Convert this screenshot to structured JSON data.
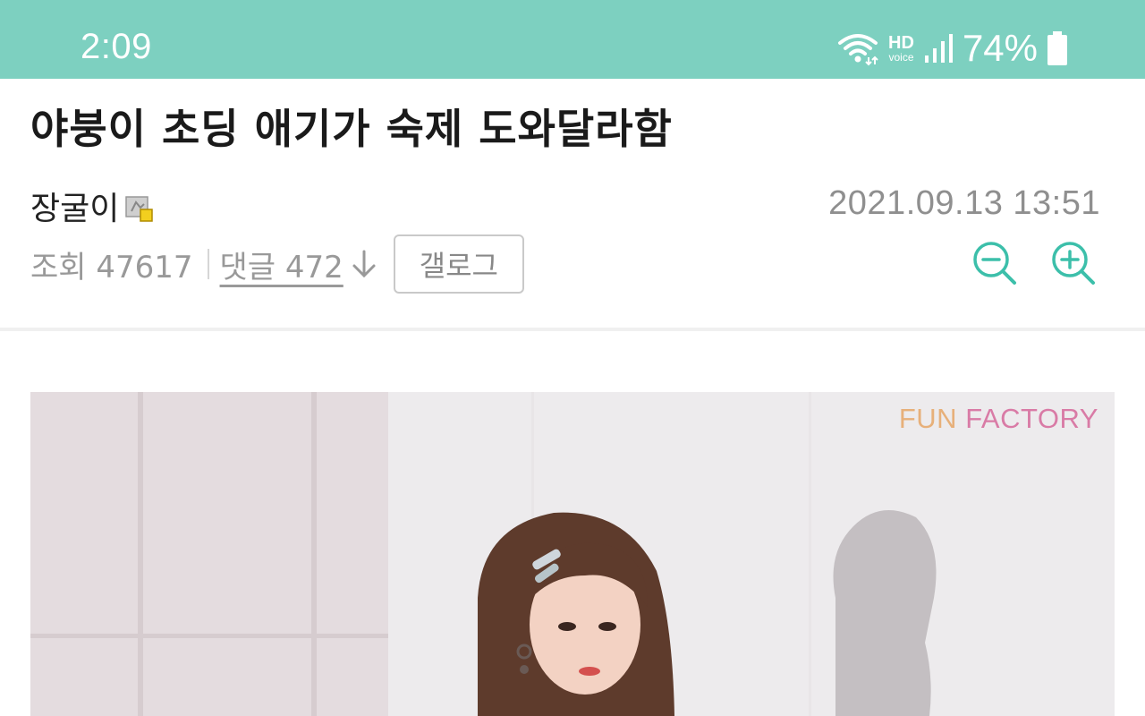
{
  "status_bar": {
    "time": "2:09",
    "network_label": "HD",
    "network_sublabel": "voice",
    "battery_percent": "74%",
    "background_color": "#7dd0c0"
  },
  "post": {
    "title": "야붕이 초딩 애기가 숙제 도와달라함",
    "author": "장굴이",
    "author_badge_icon": "member-badge-icon",
    "date": "2021.09.13 13:51",
    "views_label": "조회 47617",
    "comments_label": "댓글 472",
    "gallog_label": "갤로그"
  },
  "controls": {
    "zoom_out_icon": "zoom-out-icon",
    "zoom_in_icon": "zoom-in-icon",
    "accent_color": "#3cbfaa"
  },
  "image": {
    "watermark_part1": "FUN",
    "watermark_part2": "FACTORY"
  }
}
